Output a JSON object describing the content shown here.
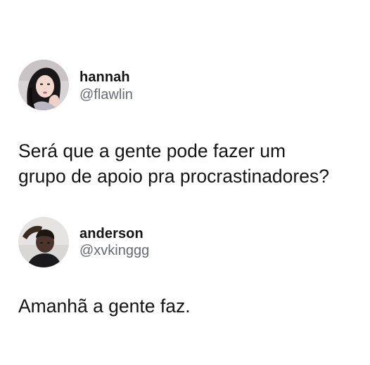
{
  "tweets": [
    {
      "display_name": "hannah",
      "handle": "@flawlin",
      "text": "Será que a gente pode fazer um\ngrupo de apoio pra procrastinadores?",
      "avatar_icon": "profile-photo-woman"
    },
    {
      "display_name": "anderson",
      "handle": "@xvkinggg",
      "text": "Amanhã a gente faz.",
      "avatar_icon": "profile-photo-man"
    }
  ],
  "colors": {
    "background": "#ffffff",
    "text": "#141414",
    "handle": "#666a70"
  }
}
